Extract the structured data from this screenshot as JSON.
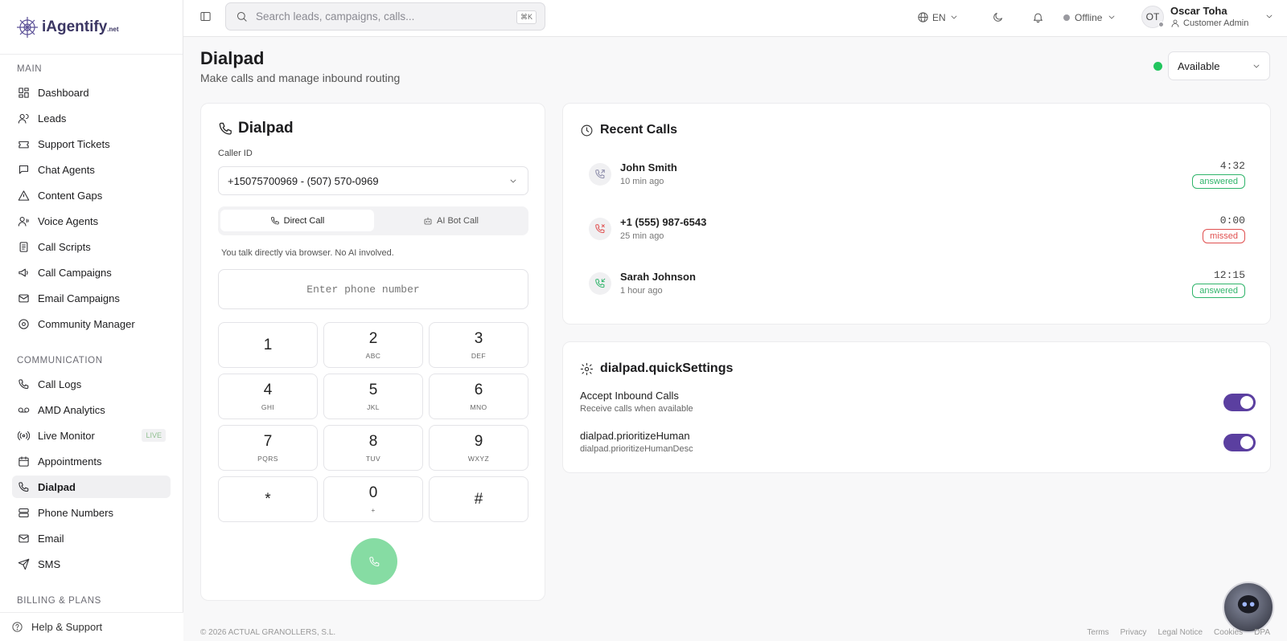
{
  "brand": {
    "name": "iAgentify",
    "suffix": ".net"
  },
  "sidebar": {
    "sections": [
      {
        "title": "MAIN",
        "items": [
          {
            "label": "Dashboard",
            "icon": "grid-icon"
          },
          {
            "label": "Leads",
            "icon": "users-icon"
          },
          {
            "label": "Support Tickets",
            "icon": "ticket-icon"
          },
          {
            "label": "Chat Agents",
            "icon": "chat-icon"
          },
          {
            "label": "Content Gaps",
            "icon": "warning-icon"
          },
          {
            "label": "Voice Agents",
            "icon": "voice-agents-icon"
          },
          {
            "label": "Call Scripts",
            "icon": "script-icon"
          },
          {
            "label": "Call Campaigns",
            "icon": "megaphone-icon"
          },
          {
            "label": "Email Campaigns",
            "icon": "mail-icon"
          },
          {
            "label": "Community Manager",
            "icon": "community-icon"
          }
        ]
      },
      {
        "title": "COMMUNICATION",
        "items": [
          {
            "label": "Call Logs",
            "icon": "phone-log-icon"
          },
          {
            "label": "AMD Analytics",
            "icon": "voicemail-icon"
          },
          {
            "label": "Live Monitor",
            "icon": "radio-icon",
            "badge": "LIVE"
          },
          {
            "label": "Appointments",
            "icon": "calendar-icon"
          },
          {
            "label": "Dialpad",
            "icon": "phone-icon",
            "active": true
          },
          {
            "label": "Phone Numbers",
            "icon": "server-icon"
          },
          {
            "label": "Email",
            "icon": "mail-icon"
          },
          {
            "label": "SMS",
            "icon": "send-icon"
          }
        ]
      },
      {
        "title": "BILLING & PLANS",
        "items": []
      }
    ],
    "help": "Help & Support"
  },
  "topbar": {
    "search_placeholder": "Search leads, campaigns, calls...",
    "shortcut": "⌘K",
    "language": "EN",
    "status": "Offline",
    "user_initials": "OT",
    "user_name": "Oscar Toha",
    "user_role": "Customer Admin"
  },
  "page": {
    "title": "Dialpad",
    "subtitle": "Make calls and manage inbound routing",
    "availability": "Available",
    "availability_color": "#22c55e"
  },
  "dialpad": {
    "title": "Dialpad",
    "caller_id_label": "Caller ID",
    "caller_id_value": "+15075700969 - (507) 570-0969",
    "mode_direct": "Direct Call",
    "mode_bot": "AI Bot Call",
    "hint": "You talk directly via browser. No AI involved.",
    "phone_placeholder": "Enter phone number",
    "keys": [
      {
        "d": "1",
        "l": ""
      },
      {
        "d": "2",
        "l": "ABC"
      },
      {
        "d": "3",
        "l": "DEF"
      },
      {
        "d": "4",
        "l": "GHI"
      },
      {
        "d": "5",
        "l": "JKL"
      },
      {
        "d": "6",
        "l": "MNO"
      },
      {
        "d": "7",
        "l": "PQRS"
      },
      {
        "d": "8",
        "l": "TUV"
      },
      {
        "d": "9",
        "l": "WXYZ"
      },
      {
        "d": "*",
        "l": ""
      },
      {
        "d": "0",
        "l": "+"
      },
      {
        "d": "#",
        "l": ""
      }
    ]
  },
  "recent": {
    "title": "Recent Calls",
    "calls": [
      {
        "name": "John Smith",
        "time": "10 min ago",
        "duration": "4:32",
        "status": "answered",
        "direction": "outgoing"
      },
      {
        "name": "+1 (555) 987-6543",
        "time": "25 min ago",
        "duration": "0:00",
        "status": "missed",
        "direction": "missed"
      },
      {
        "name": "Sarah Johnson",
        "time": "1 hour ago",
        "duration": "12:15",
        "status": "answered",
        "direction": "incoming"
      }
    ]
  },
  "settings": {
    "title": "dialpad.quickSettings",
    "items": [
      {
        "label": "Accept Inbound Calls",
        "desc": "Receive calls when available",
        "on": true
      },
      {
        "label": "dialpad.prioritizeHuman",
        "desc": "dialpad.prioritizeHumanDesc",
        "on": true
      }
    ]
  },
  "footer": {
    "copyright": "© 2026 ACTUAL GRANOLLERS, S.L.",
    "links": [
      "Terms",
      "Privacy",
      "Legal Notice",
      "Cookies",
      "DPA"
    ]
  }
}
